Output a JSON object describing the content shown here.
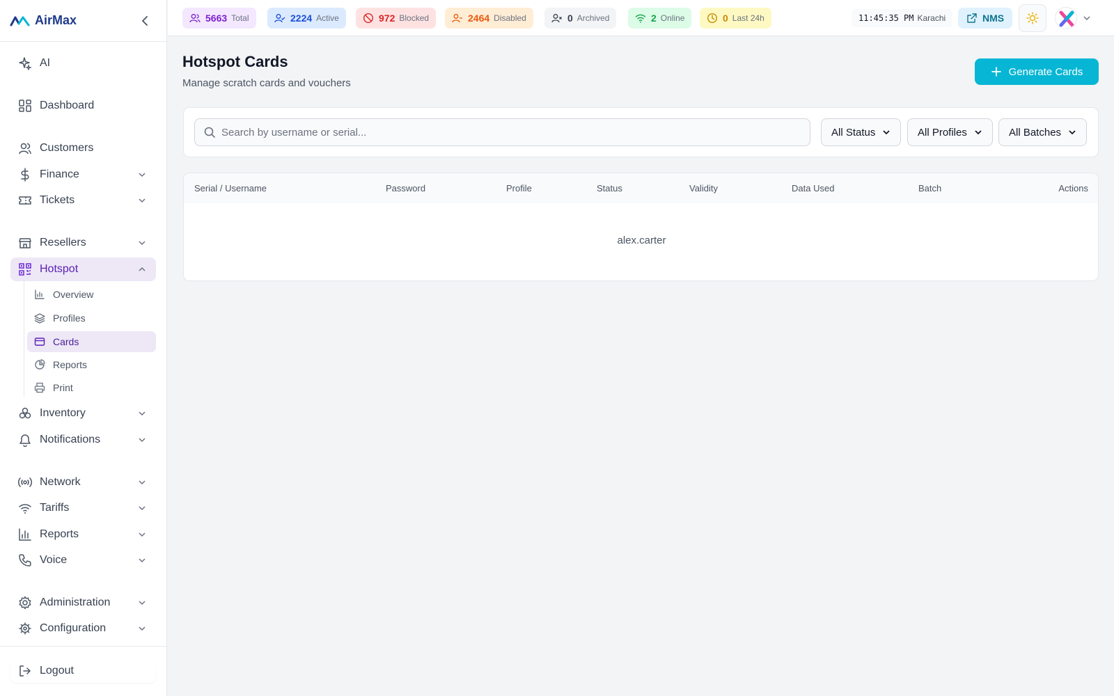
{
  "brand": {
    "name": "AirMax",
    "accent": "#1e3a8a"
  },
  "sidebar": {
    "items": [
      {
        "label": "AI",
        "icon": "sparkles-icon"
      },
      {
        "label": "Dashboard",
        "icon": "grid-icon"
      },
      {
        "label": "Customers",
        "icon": "users-icon"
      },
      {
        "label": "Finance",
        "icon": "dollar-icon"
      },
      {
        "label": "Tickets",
        "icon": "ticket-icon"
      },
      {
        "label": "Resellers",
        "icon": "store-icon"
      },
      {
        "label": "Hotspot",
        "icon": "qr-code-icon"
      },
      {
        "label": "Inventory",
        "icon": "boxes-icon"
      },
      {
        "label": "Notifications",
        "icon": "bell-icon"
      },
      {
        "label": "Network",
        "icon": "radio-icon"
      },
      {
        "label": "Tariffs",
        "icon": "wifi-icon"
      },
      {
        "label": "Reports",
        "icon": "bar-chart-icon"
      },
      {
        "label": "Voice",
        "icon": "phone-icon"
      },
      {
        "label": "Administration",
        "icon": "gear-icon"
      },
      {
        "label": "Configuration",
        "icon": "cog-icon"
      }
    ],
    "hotspot_sub": [
      {
        "label": "Overview",
        "icon": "chart-icon"
      },
      {
        "label": "Profiles",
        "icon": "layers-icon"
      },
      {
        "label": "Cards",
        "icon": "card-icon"
      },
      {
        "label": "Reports",
        "icon": "pie-icon"
      },
      {
        "label": "Print",
        "icon": "printer-icon"
      }
    ],
    "logout": "Logout",
    "active_color": "#ede7f6"
  },
  "stats": [
    {
      "value": "5663",
      "label": "Total",
      "icon": "users-icon",
      "bg": "#f3e8ff",
      "color": "#7e22ce"
    },
    {
      "value": "2224",
      "label": "Active",
      "icon": "user-check-icon",
      "bg": "#dbeafe",
      "color": "#1d4ed8"
    },
    {
      "value": "972",
      "label": "Blocked",
      "icon": "ban-icon",
      "bg": "#fee2e2",
      "color": "#dc2626"
    },
    {
      "value": "2464",
      "label": "Disabled",
      "icon": "user-minus-icon",
      "bg": "#ffedd5",
      "color": "#ea580c"
    },
    {
      "value": "0",
      "label": "Archived",
      "icon": "user-x-icon",
      "bg": "#f3f4f6",
      "color": "#374151"
    },
    {
      "value": "2",
      "label": "Online",
      "icon": "wifi-icon",
      "bg": "#dcfce7",
      "color": "#16a34a"
    },
    {
      "value": "0",
      "label": "Last 24h",
      "icon": "clock-icon",
      "bg": "#fef9c3",
      "color": "#ca8a04"
    }
  ],
  "clock": {
    "time": "11:45:35 PM",
    "zone": "Karachi"
  },
  "nms_label": "NMS",
  "page": {
    "title": "Hotspot Cards",
    "subtitle": "Manage scratch cards and vouchers",
    "generate_label": "Generate Cards"
  },
  "filters": {
    "search_placeholder": "Search by username or serial...",
    "status": "All Status",
    "profiles": "All Profiles",
    "batches": "All Batches"
  },
  "table": {
    "columns": [
      "Serial / Username",
      "Password",
      "Profile",
      "Status",
      "Validity",
      "Data Used",
      "Batch",
      "Actions"
    ],
    "empty_text": "alex.carter"
  }
}
